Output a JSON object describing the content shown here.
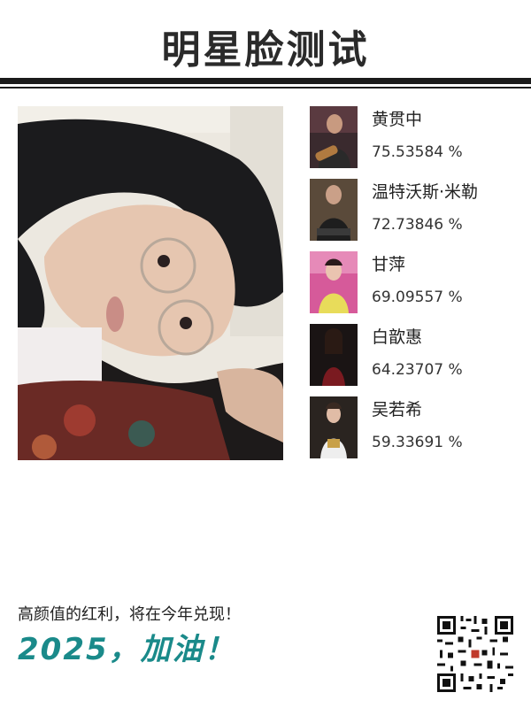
{
  "title": "明星脸测试",
  "matches": [
    {
      "name": "黄贯中",
      "score": "75.53584 %"
    },
    {
      "name": "温特沃斯·米勒",
      "score": "72.73846 %"
    },
    {
      "name": "甘萍",
      "score": "69.09557 %"
    },
    {
      "name": "白歆惠",
      "score": "64.23707 %"
    },
    {
      "name": "吴若希",
      "score": "59.33691 %"
    }
  ],
  "footer": {
    "line1": "高颜值的红利，将在今年兑现！",
    "line2": "2025，加油！"
  },
  "colors": {
    "accent": "#1a8a8a",
    "rule": "#1a1a1a"
  },
  "icons": {
    "qr": "qr-code-icon"
  }
}
